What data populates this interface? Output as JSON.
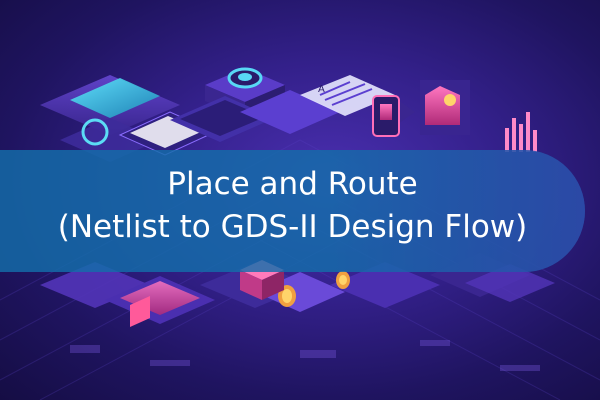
{
  "banner": {
    "title_line_1": "Place and Route",
    "title_line_2": "(Netlist to GDS-II Design Flow)"
  },
  "colors": {
    "background": "#2a1a78",
    "banner": "#146eaa",
    "title_text": "#ffffff",
    "accent_cyan": "#38d6f0",
    "accent_pink": "#e0509a",
    "accent_orange": "#f0a040"
  },
  "icons": [
    "isometric-tech-city-illustration",
    "camera-icon",
    "monitor-icon",
    "document-icon",
    "bar-chart-icon",
    "coin-icon"
  ]
}
